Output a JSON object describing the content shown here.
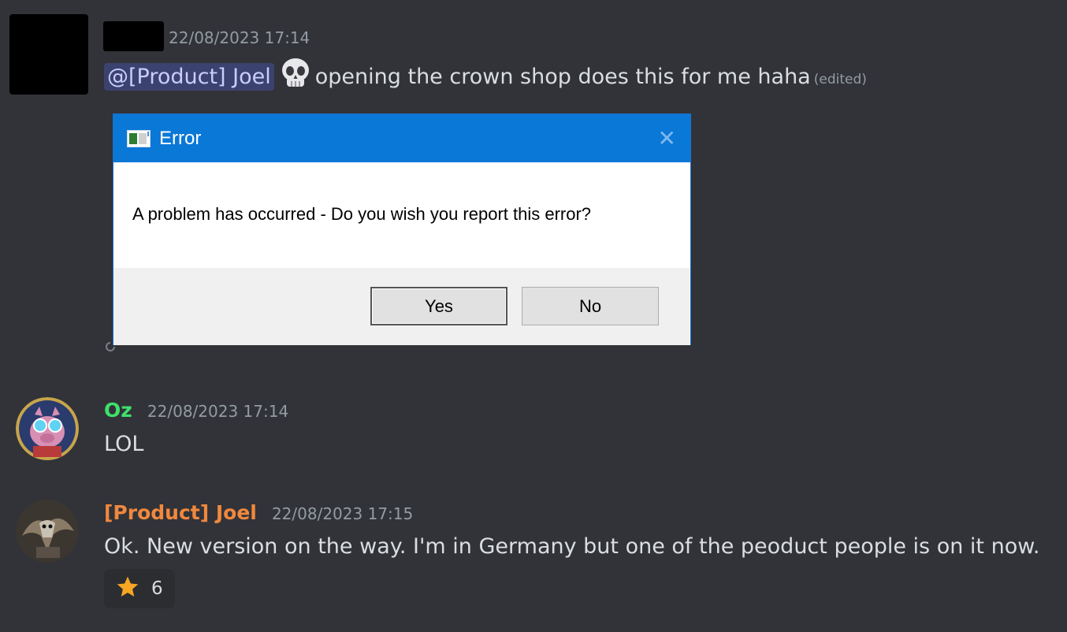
{
  "messages": [
    {
      "author": "",
      "timestamp": "22/08/2023 17:14",
      "mention": "@[Product] Joel",
      "emoji": "skull-icon",
      "text": "opening the crown shop does this for me haha",
      "edited": "(edited)"
    },
    {
      "author": "Oz",
      "author_color": "#3ee06b",
      "timestamp": "22/08/2023 17:14",
      "text": "LOL"
    },
    {
      "author": "[Product] Joel",
      "author_color": "#f0883e",
      "timestamp": "22/08/2023 17:15",
      "text": "Ok. New version on the way. I'm in Germany but one of the peoduct people is on it now."
    }
  ],
  "dialog": {
    "title": "Error",
    "close": "✕",
    "message": "A problem has occurred - Do you wish you report this error?",
    "yes": "Yes",
    "no": "No"
  },
  "reaction": {
    "emoji": "star-icon",
    "count": "6"
  }
}
